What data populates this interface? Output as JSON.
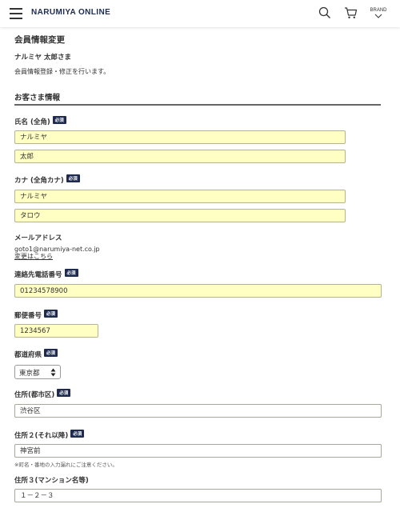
{
  "header": {
    "logo": "NARUMIYA ONLINE",
    "brand_label": "BRAND",
    "icons": [
      "hamburger-menu-icon",
      "search-icon",
      "cart-icon",
      "chevron-down-icon"
    ]
  },
  "page": {
    "title": "会員情報変更",
    "user_name": "ナルミヤ 太郎さま",
    "intro": "会員情報登録・修正を行います。"
  },
  "section": {
    "title": "お客さま情報"
  },
  "required_badge": "必須",
  "fields": {
    "name": {
      "label": "氏名 (全角)",
      "last": "ナルミヤ",
      "first": "太郎"
    },
    "kana": {
      "label": "カナ (全角カナ)",
      "last": "ナルミヤ",
      "first": "タロウ"
    },
    "email": {
      "label": "メールアドレス",
      "value": "goto1@narumiya-net.co.jp",
      "change_link": "変更はこちら"
    },
    "phone": {
      "label": "連絡先電話番号",
      "value": "01234578900"
    },
    "postal": {
      "label": "郵便番号",
      "value": "1234567"
    },
    "prefecture": {
      "label": "都道府県",
      "value": "東京都"
    },
    "address1": {
      "label": "住所(都市区)",
      "value": "渋谷区"
    },
    "address2": {
      "label": "住所２(それ以降)",
      "value": "神宮前",
      "note": "※町名・番地の入力漏れにご注意ください。"
    },
    "address3": {
      "label": "住所３(マンション名等)",
      "value": "１－２－３"
    }
  },
  "colors": {
    "brand_navy": "#1e2b4f",
    "filled_field": "#ffffc3"
  }
}
